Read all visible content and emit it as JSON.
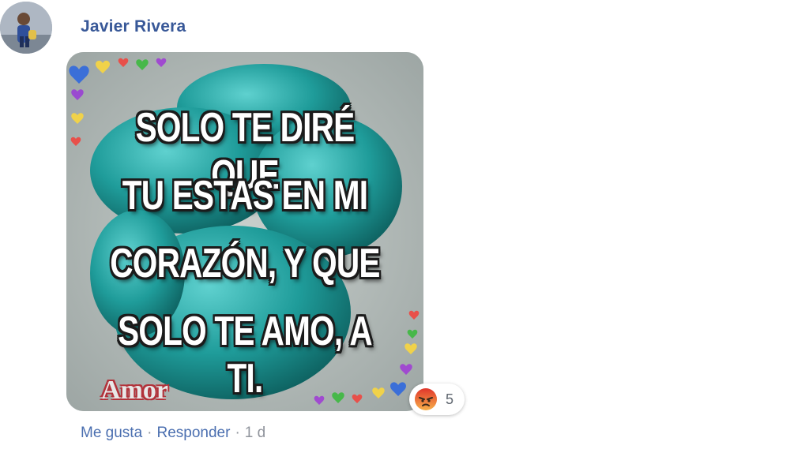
{
  "comment": {
    "author": "Javier Rivera",
    "avatar_icon": "profile-photo-icon",
    "image": {
      "text_lines": [
        "SOLO TE DIRÉ QUE",
        "TU ESTAS EN MI",
        "CORAZÓN, Y QUE",
        "SOLO TE AMO, A TI."
      ],
      "watermark": "Amor"
    },
    "reaction": {
      "icon": "angry-reaction-icon",
      "count": "5"
    },
    "actions": {
      "like": "Me gusta",
      "reply": "Responder",
      "separator": "·",
      "time": "1 d"
    }
  },
  "colors": {
    "author_link": "#385898",
    "action_link": "#4b6fb0",
    "meta_gray": "#90949c",
    "angry_orange": "#f0783c"
  }
}
